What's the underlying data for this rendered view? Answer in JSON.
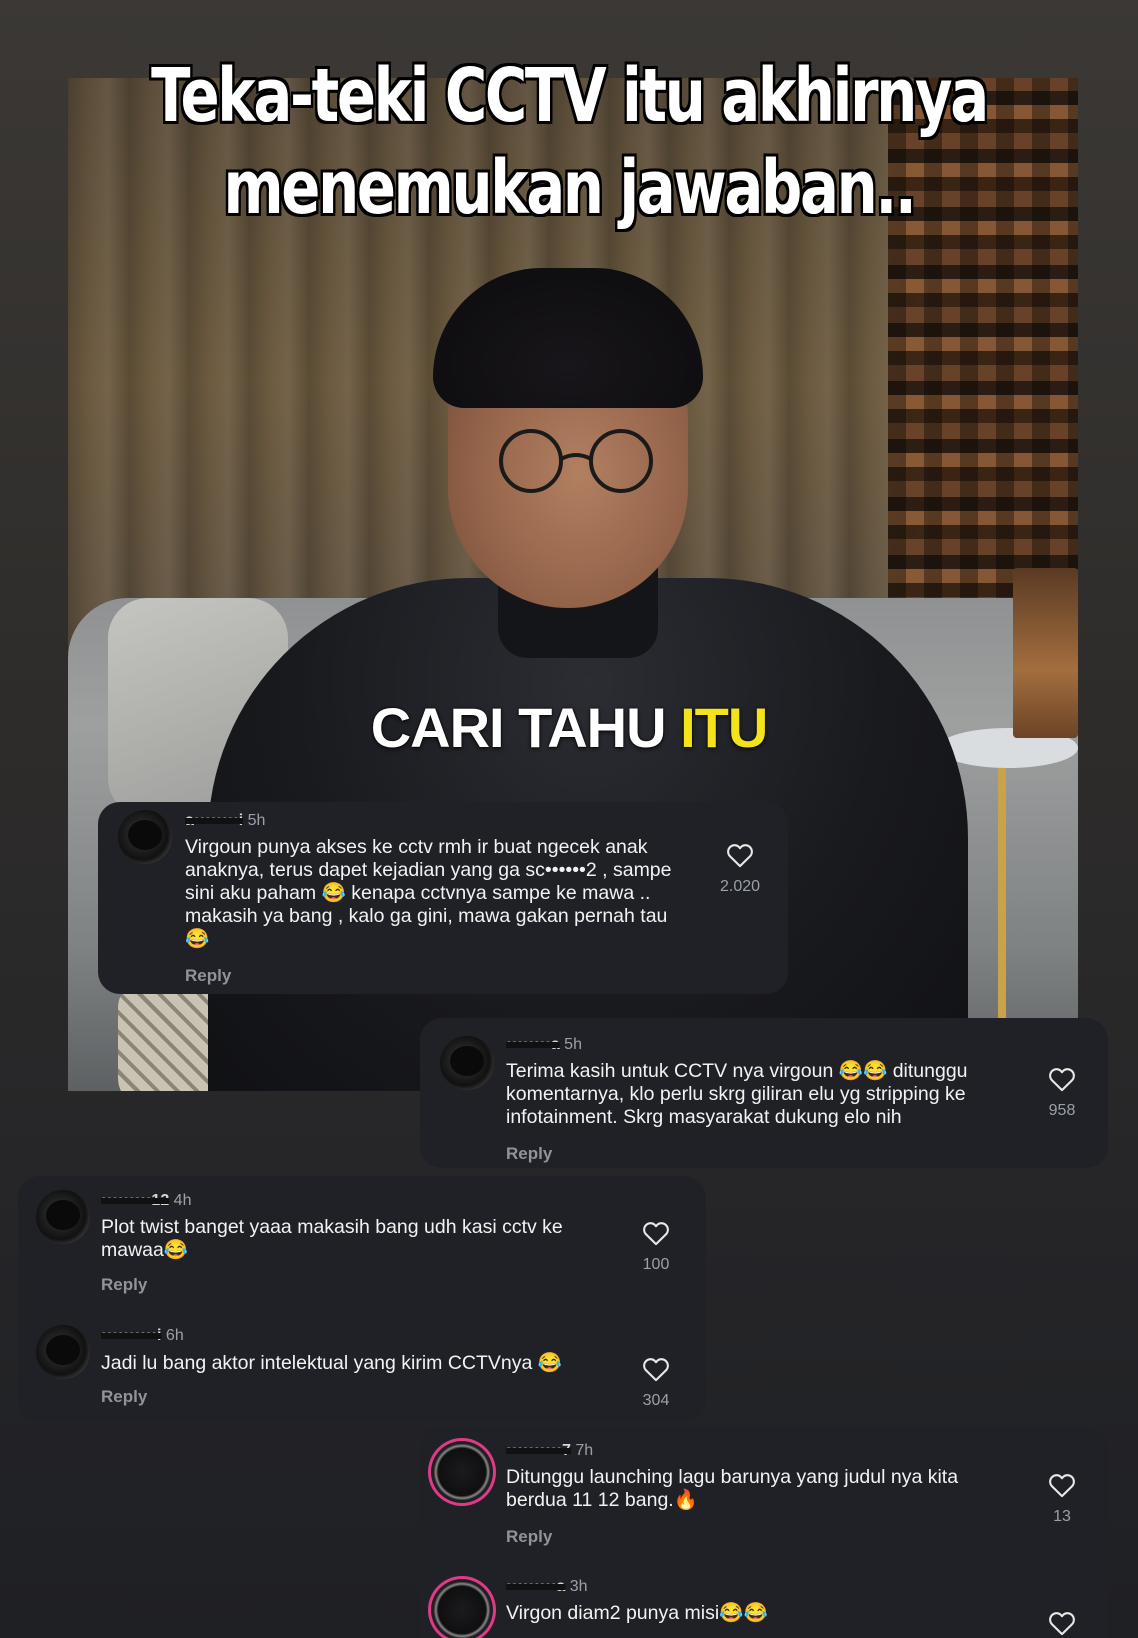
{
  "video": {
    "title_line1": "Teka-teki CCTV itu akhirnya",
    "title_line2": "menemukan jawaban..",
    "caption_main": "CARI TAHU ",
    "caption_highlight": "ITU"
  },
  "comments": [
    {
      "username": "a••••••••i",
      "time": "5h",
      "text": "Virgoun punya akses ke cctv rmh ir buat ngecek anak anaknya, terus dapet kejadian yang ga sc••••••2 , sampe sini aku paham 😂 kenapa cctvnya sampe ke mawa .. makasih ya bang , kalo ga gini, mawa gakan pernah tau 😂",
      "reply": "Reply",
      "likes": "2.020"
    },
    {
      "username": "••••••••a",
      "time": "5h",
      "text": "Terima kasih untuk CCTV nya virgoun 😂😂 ditunggu komentarnya, klo perlu skrg giliran elu yg stripping ke infotainment. Skrg masyarakat dukung elo nih",
      "reply": "Reply",
      "likes": "958"
    },
    {
      "username": "•••••••••12",
      "time": "4h",
      "text": "Plot twist banget yaaa makasih bang udh kasi cctv ke mawaa😂",
      "reply": "Reply",
      "likes": "100"
    },
    {
      "username": "••••••••••i",
      "time": "6h",
      "text": "Jadi lu bang aktor intelektual  yang kirim CCTVnya 😂",
      "reply": "Reply",
      "likes": "304"
    },
    {
      "username": "••••••••••7",
      "time": "7h",
      "text": "Ditunggu launching lagu barunya yang judul nya kita berdua 11 12 bang.🔥",
      "reply": "Reply",
      "likes": "13"
    },
    {
      "username": "•••••••••a",
      "time": "3h",
      "text": "Virgon diam2 punya misi😂😂"
    }
  ],
  "icons": {
    "like": "heart-outline-icon"
  },
  "colors": {
    "caption_highlight": "#f4e21b",
    "card_bg": "#202127",
    "story_ring": "#e03a86"
  }
}
